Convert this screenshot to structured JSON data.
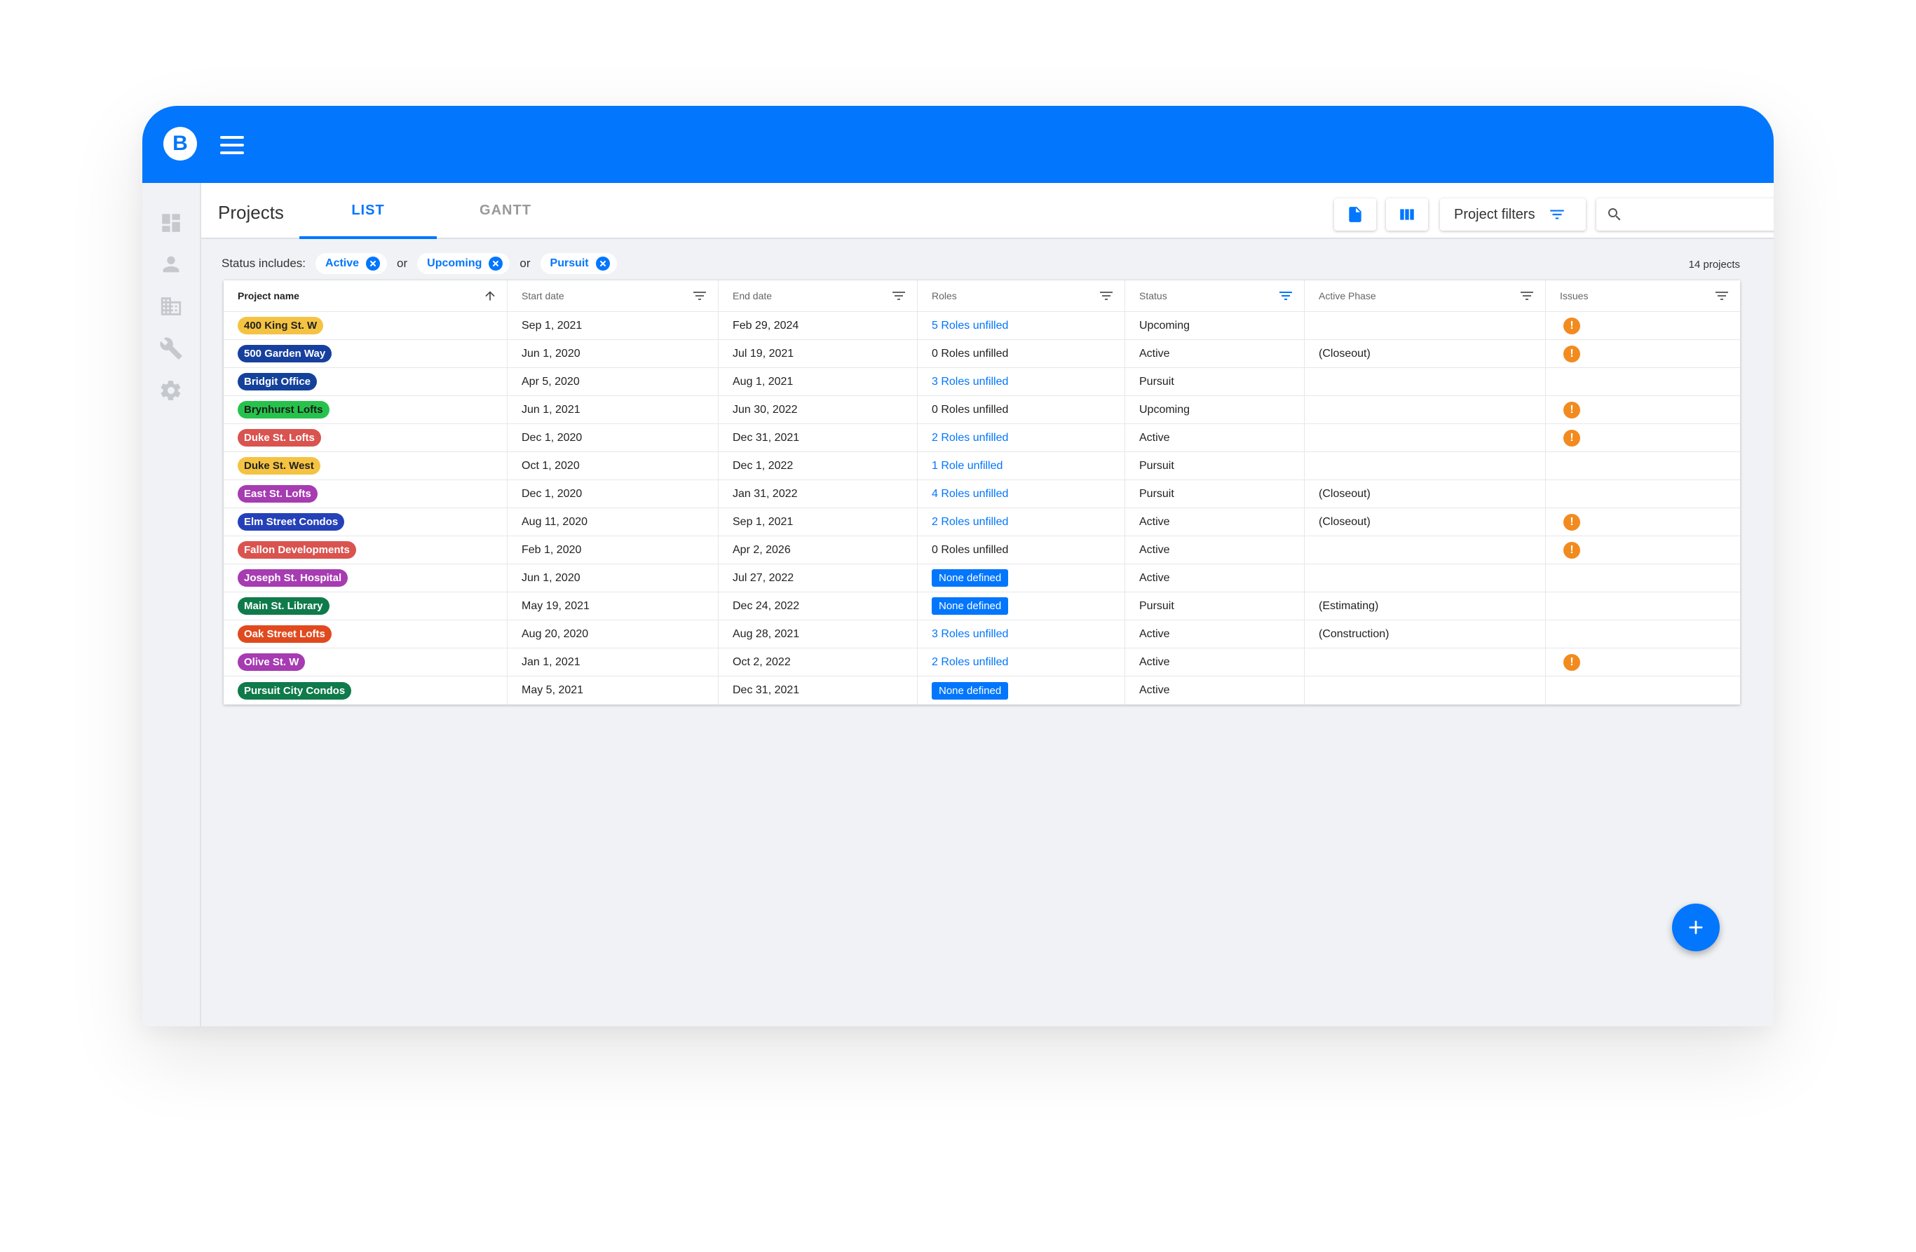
{
  "app": {
    "logo_letter": "B"
  },
  "header": {
    "title": "Projects",
    "tabs": [
      "LIST",
      "GANTT"
    ],
    "filters_label": "Project filters",
    "search_placeholder": ""
  },
  "status_filter": {
    "label": "Status includes:",
    "chips": [
      "Active",
      "Upcoming",
      "Pursuit"
    ],
    "separator": "or",
    "count": "14 projects"
  },
  "table": {
    "columns": [
      "Project name",
      "Start date",
      "End date",
      "Roles",
      "Status",
      "Active Phase",
      "Issues"
    ],
    "rows": [
      {
        "name": "400 King St. W",
        "name_bg": "#f5c342",
        "name_fg": "#222222",
        "start": "Sep 1, 2021",
        "end": "Feb 29, 2024",
        "roles": "5 Roles unfilled",
        "roles_style": "link",
        "status": "Upcoming",
        "phase": "",
        "issue": true
      },
      {
        "name": "500 Garden Way",
        "name_bg": "#17409e",
        "name_fg": "#ffffff",
        "start": "Jun 1, 2020",
        "end": "Jul 19, 2021",
        "roles": "0 Roles unfilled",
        "roles_style": "plain",
        "status": "Active",
        "phase": "(Closeout)",
        "issue": true
      },
      {
        "name": "Bridgit Office",
        "name_bg": "#14429b",
        "name_fg": "#ffffff",
        "start": "Apr 5, 2020",
        "end": "Aug 1, 2021",
        "roles": "3 Roles unfilled",
        "roles_style": "link",
        "status": "Pursuit",
        "phase": "",
        "issue": false
      },
      {
        "name": "Brynhurst Lofts",
        "name_bg": "#27c24c",
        "name_fg": "#1a1a1a",
        "start": "Jun 1, 2021",
        "end": "Jun 30, 2022",
        "roles": "0 Roles unfilled",
        "roles_style": "plain",
        "status": "Upcoming",
        "phase": "",
        "issue": true
      },
      {
        "name": "Duke St. Lofts",
        "name_bg": "#d9534f",
        "name_fg": "#ffffff",
        "start": "Dec 1, 2020",
        "end": "Dec 31, 2021",
        "roles": "2 Roles unfilled",
        "roles_style": "link",
        "status": "Active",
        "phase": "",
        "issue": true
      },
      {
        "name": "Duke St. West",
        "name_bg": "#f5c342",
        "name_fg": "#222222",
        "start": "Oct 1, 2020",
        "end": "Dec 1, 2022",
        "roles": "1 Role unfilled",
        "roles_style": "link",
        "status": "Pursuit",
        "phase": "",
        "issue": false
      },
      {
        "name": "East St. Lofts",
        "name_bg": "#a63bb2",
        "name_fg": "#ffffff",
        "start": "Dec 1, 2020",
        "end": "Jan 31, 2022",
        "roles": "4 Roles unfilled",
        "roles_style": "link",
        "status": "Pursuit",
        "phase": "(Closeout)",
        "issue": false
      },
      {
        "name": "Elm Street Condos",
        "name_bg": "#2541b8",
        "name_fg": "#ffffff",
        "start": "Aug 11, 2020",
        "end": "Sep 1, 2021",
        "roles": "2 Roles unfilled",
        "roles_style": "link",
        "status": "Active",
        "phase": "(Closeout)",
        "issue": true
      },
      {
        "name": "Fallon Developments",
        "name_bg": "#d9534f",
        "name_fg": "#ffffff",
        "start": "Feb 1, 2020",
        "end": "Apr 2, 2026",
        "roles": "0 Roles unfilled",
        "roles_style": "plain",
        "status": "Active",
        "phase": "",
        "issue": true
      },
      {
        "name": "Joseph St. Hospital",
        "name_bg": "#a63bb2",
        "name_fg": "#ffffff",
        "start": "Jun 1, 2020",
        "end": "Jul 27, 2022",
        "roles": "None defined",
        "roles_style": "badge",
        "status": "Active",
        "phase": "",
        "issue": false
      },
      {
        "name": "Main St. Library",
        "name_bg": "#0f7a4a",
        "name_fg": "#ffffff",
        "start": "May 19, 2021",
        "end": "Dec 24, 2022",
        "roles": "None defined",
        "roles_style": "badge",
        "status": "Pursuit",
        "phase": "(Estimating)",
        "issue": false
      },
      {
        "name": "Oak Street Lofts",
        "name_bg": "#e04a1f",
        "name_fg": "#ffffff",
        "start": "Aug 20, 2020",
        "end": "Aug 28, 2021",
        "roles": "3 Roles unfilled",
        "roles_style": "link",
        "status": "Active",
        "phase": "(Construction)",
        "issue": false
      },
      {
        "name": "Olive St. W",
        "name_bg": "#a63bb2",
        "name_fg": "#ffffff",
        "start": "Jan 1, 2021",
        "end": "Oct 2, 2022",
        "roles": "2 Roles unfilled",
        "roles_style": "link",
        "status": "Active",
        "phase": "",
        "issue": true
      },
      {
        "name": "Pursuit City Condos",
        "name_bg": "#0f7a4a",
        "name_fg": "#ffffff",
        "start": "May 5, 2021",
        "end": "Dec 31, 2021",
        "roles": "None defined",
        "roles_style": "badge",
        "status": "Active",
        "phase": "",
        "issue": false
      }
    ],
    "issue_glyph": "!"
  },
  "colors": {
    "brand": "#0276fd",
    "issue": "#f28b1f"
  },
  "icons": [
    "menu-icon",
    "dashboard-icon",
    "person-icon",
    "building-icon",
    "wrench-icon",
    "gear-icon",
    "document-icon",
    "columns-icon",
    "filter-icon",
    "search-icon",
    "sort-up-icon",
    "close-icon",
    "plus-icon"
  ]
}
